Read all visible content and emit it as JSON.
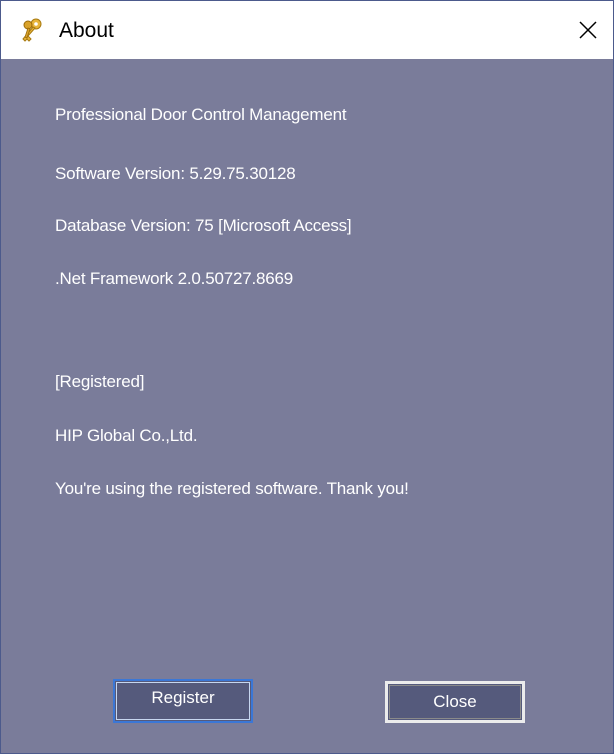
{
  "window": {
    "title": "About",
    "icon": "keys-icon",
    "close_icon": "close-icon"
  },
  "content": {
    "product": "Professional Door Control Management",
    "software_version": "Software Version: 5.29.75.30128",
    "database_version": "Database Version: 75  [Microsoft Access]",
    "framework": ".Net Framework 2.0.50727.8669",
    "status": "[Registered]",
    "company": "HIP Global Co.,Ltd.",
    "message": "You're using the registered software. Thank you!"
  },
  "buttons": {
    "register": "Register",
    "close": "Close"
  },
  "colors": {
    "background": "#7a7c9a",
    "button_bg": "#555a7c",
    "focus_border": "#3b77d6"
  }
}
